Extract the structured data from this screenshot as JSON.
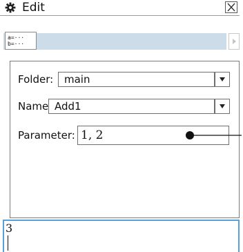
{
  "window": {
    "title": "Edit",
    "title_icon": "gear-icon",
    "close_icon": "close-icon"
  },
  "toolbar": {
    "assign_button_line1": "a=···",
    "assign_button_line2": "b=···",
    "scroll_icon": "scroll-right-icon",
    "strip_color": "#ccdde9"
  },
  "form": {
    "folder_label": "Folder:",
    "folder_value": "main",
    "name_label": "Name:",
    "name_value": "Add1",
    "parameter_label": "Parameter:",
    "parameter_value": "1, 2",
    "dropdown_icon": "chevron-down-icon"
  },
  "entry": {
    "value": "3",
    "border_color": "#5aa0d8"
  }
}
